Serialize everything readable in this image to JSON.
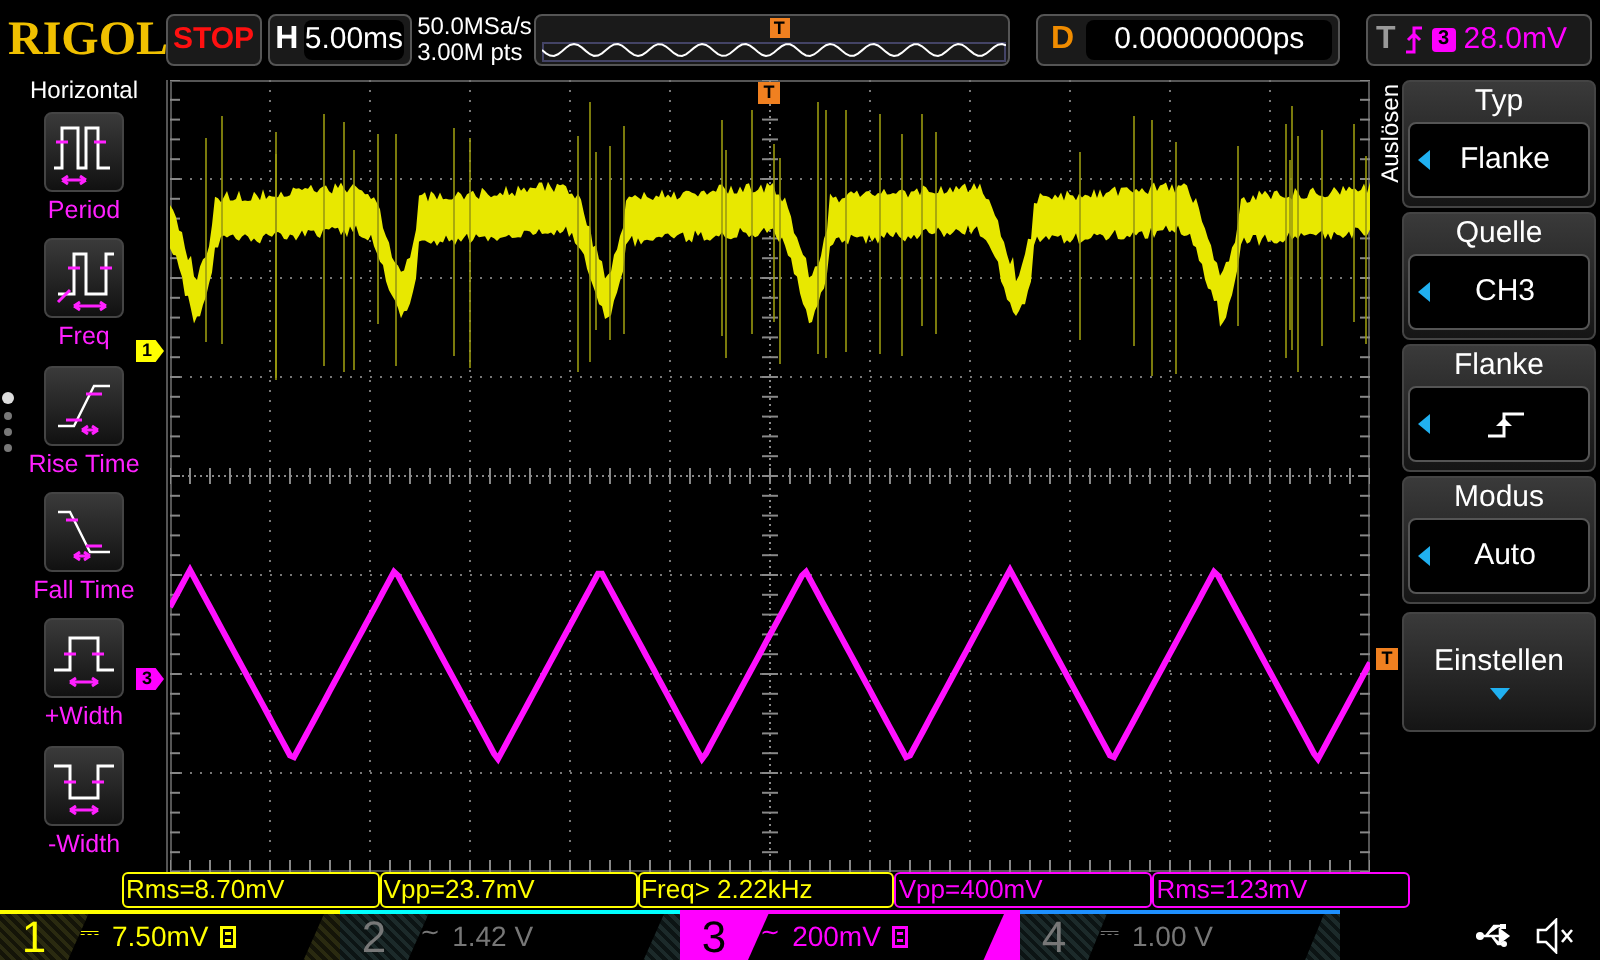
{
  "brand": "RIGOL",
  "run_state": "STOP",
  "horizontal": {
    "label": "H",
    "timebase": "5.00ms"
  },
  "acquisition": {
    "sample_rate": "50.0MSa/s",
    "memory_depth": "3.00M pts"
  },
  "overview": {
    "trigger_marker": "T"
  },
  "delay": {
    "label": "D",
    "value": "0.00000000ps"
  },
  "trigger": {
    "label": "T",
    "source": "3",
    "level": "28.0mV",
    "color": "#ff00ff"
  },
  "left_panel": {
    "title": "Horizontal",
    "items": [
      {
        "kind": "period",
        "label": "Period"
      },
      {
        "kind": "freq",
        "label": "Freq"
      },
      {
        "kind": "rise",
        "label": "Rise Time"
      },
      {
        "kind": "fall",
        "label": "Fall Time"
      },
      {
        "kind": "pwidth",
        "label": "+Width"
      },
      {
        "kind": "nwidth",
        "label": "-Width"
      }
    ],
    "pages": [
      {
        "selected": true
      },
      {
        "selected": false
      },
      {
        "selected": false
      },
      {
        "selected": false
      }
    ]
  },
  "plot": {
    "channel_markers": [
      {
        "label": "1",
        "color": "#ffff00"
      },
      {
        "label": "3",
        "color": "#ff00ff"
      }
    ],
    "trigger_position_marker": "T",
    "trigger_level_marker": "T"
  },
  "right_menu": {
    "title": "Auslösen",
    "items": [
      {
        "kind": "value",
        "label": "Typ",
        "value": "Flanke"
      },
      {
        "kind": "value",
        "label": "Quelle",
        "value": "CH3"
      },
      {
        "kind": "edge",
        "label": "Flanke"
      },
      {
        "kind": "value",
        "label": "Modus",
        "value": "Auto"
      }
    ],
    "button": "Einstellen"
  },
  "measurements": [
    {
      "text": "Rms=8.70mV",
      "color": "#ffff00"
    },
    {
      "text": "Vpp=23.7mV",
      "color": "#ffff00"
    },
    {
      "text": "Freq> 2.22kHz",
      "color": "#ffff00"
    },
    {
      "text": "Vpp=400mV",
      "color": "#ff00ff"
    },
    {
      "text": "Rms=123mV",
      "color": "#ff00ff"
    }
  ],
  "channels": [
    {
      "number": "1",
      "coupling": "⎓",
      "scale": "7.50mV",
      "bandwidth_limit": true,
      "enabled": true,
      "selected": false,
      "color": "#ffff00"
    },
    {
      "number": "2",
      "coupling": "~",
      "scale": "1.42 V",
      "bandwidth_limit": false,
      "enabled": false,
      "selected": false,
      "color": "#00ffff"
    },
    {
      "number": "3",
      "coupling": "~",
      "scale": "200mV",
      "bandwidth_limit": true,
      "enabled": true,
      "selected": true,
      "color": "#ff00ff"
    },
    {
      "number": "4",
      "coupling": "⎓",
      "scale": "1.00 V",
      "bandwidth_limit": false,
      "enabled": false,
      "selected": false,
      "color": "#1e90ff"
    }
  ]
}
